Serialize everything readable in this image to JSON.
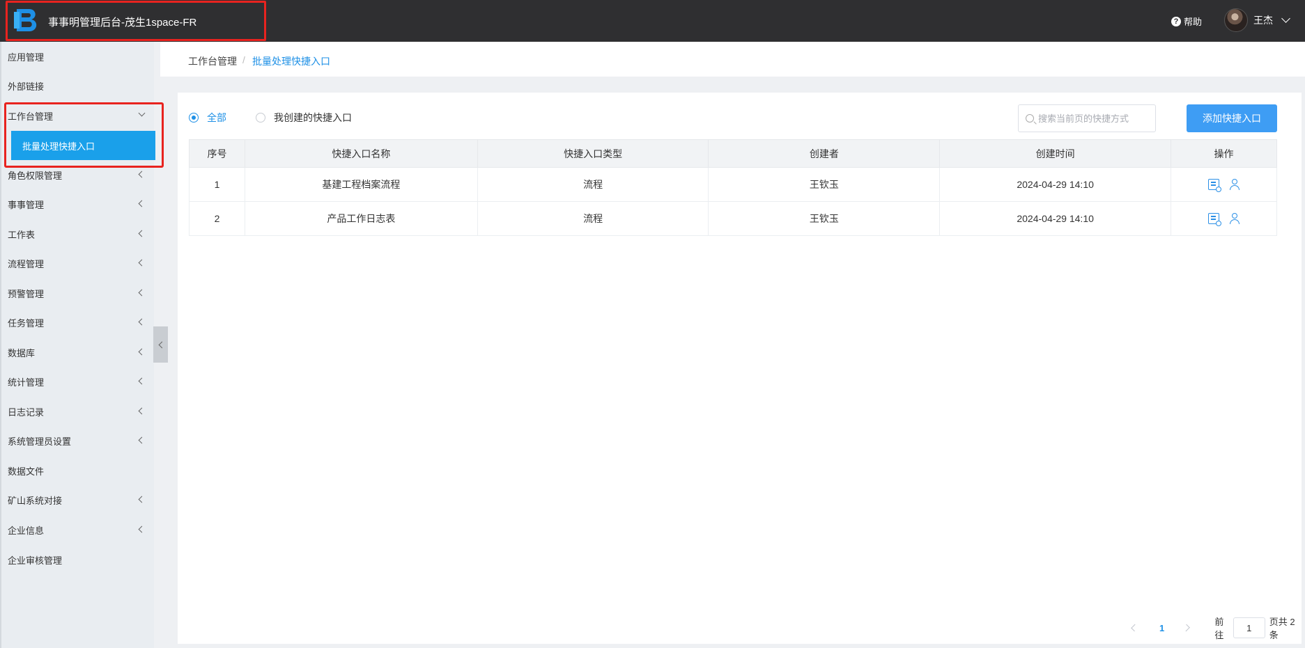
{
  "header": {
    "app_title": "事事明管理后台-茂生1space-FR",
    "logo": "b-logo-icon",
    "help_label": "帮助",
    "help_icon": "?",
    "user_name": "王杰"
  },
  "sidebar": {
    "items": [
      {
        "label": "应用管理",
        "has_children": false
      },
      {
        "label": "外部链接",
        "has_children": false
      },
      {
        "label": "工作台管理",
        "has_children": true,
        "expanded": true
      },
      {
        "label": "角色权限管理",
        "has_children": true
      },
      {
        "label": "事事管理",
        "has_children": true
      },
      {
        "label": "工作表",
        "has_children": true
      },
      {
        "label": "流程管理",
        "has_children": true
      },
      {
        "label": "预警管理",
        "has_children": true
      },
      {
        "label": "任务管理",
        "has_children": true
      },
      {
        "label": "数据库",
        "has_children": true
      },
      {
        "label": "统计管理",
        "has_children": true
      },
      {
        "label": "日志记录",
        "has_children": true
      },
      {
        "label": "系统管理员设置",
        "has_children": true
      },
      {
        "label": "数据文件",
        "has_children": false
      },
      {
        "label": "矿山系统对接",
        "has_children": true
      },
      {
        "label": "企业信息",
        "has_children": true
      },
      {
        "label": "企业审核管理",
        "has_children": false
      }
    ],
    "active_submenu": "批量处理快捷入口"
  },
  "breadcrumb": {
    "parent": "工作台管理",
    "separator": "/",
    "current": "批量处理快捷入口"
  },
  "filters": {
    "all_label": "全部",
    "mine_label": "我创建的快捷入口",
    "selected": "all"
  },
  "search": {
    "placeholder": "搜索当前页的快捷方式",
    "value": ""
  },
  "add_button_label": "添加快捷入口",
  "table": {
    "headers": [
      "序号",
      "快捷入口名称",
      "快捷入口类型",
      "创建者",
      "创建时间",
      "操作"
    ],
    "rows": [
      {
        "index": "1",
        "name": "基建工程档案流程",
        "type": "流程",
        "creator": "王钦玉",
        "created": "2024-04-29 14:10"
      },
      {
        "index": "2",
        "name": "产品工作日志表",
        "type": "流程",
        "creator": "王钦玉",
        "created": "2024-04-29 14:10"
      }
    ]
  },
  "pagination": {
    "current_page": "1",
    "goto_label": "前往",
    "goto_value": "1",
    "total_label": "页共 2 条"
  },
  "colors": {
    "accent": "#1e90e6",
    "topbar": "#2f2f31",
    "highlight": "#e8231f",
    "active_menu": "#1aa0ea"
  }
}
